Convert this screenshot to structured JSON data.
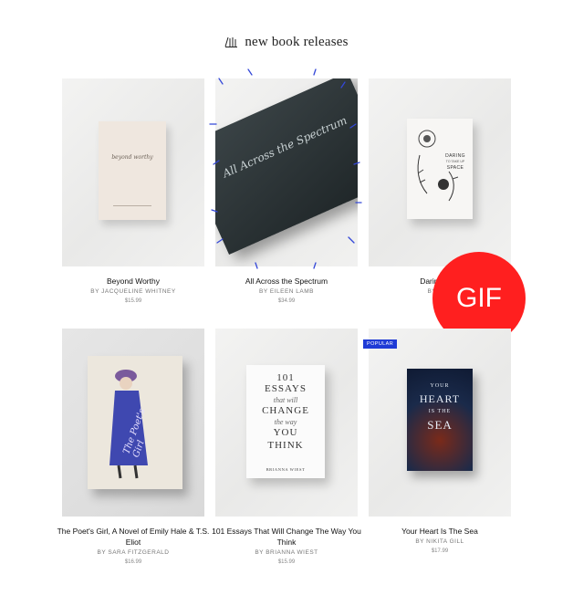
{
  "header": {
    "title": "new book releases"
  },
  "books": [
    {
      "title": "Beyond Worthy",
      "author": "BY JACQUELINE WHITNEY",
      "price": "$15.99",
      "cover_text": "beyond worthy"
    },
    {
      "title": "All Across the Spectrum",
      "author": "BY EILEEN LAMB",
      "price": "$34.99",
      "cover_text": "All Across the Spectrum"
    },
    {
      "title": "Daring To T",
      "author": "BY DAN",
      "price": "",
      "cover_text_1": "DARING",
      "cover_text_2": "TO TAKE UP",
      "cover_text_3": "SPACE"
    },
    {
      "title": "The Poet's Girl, A Novel of Emily Hale & T.S. Eliot",
      "author": "BY SARA FITZGERALD",
      "price": "$16.99",
      "cover_text": "The Poet's Girl"
    },
    {
      "title": "101 Essays That Will Change The Way You Think",
      "author": "BY BRIANNA WIEST",
      "price": "$15.99",
      "cover_lines": [
        "101",
        "ESSAYS",
        "that will",
        "CHANGE",
        "the way",
        "YOU",
        "THINK"
      ],
      "cover_author": "BRIANNA WIEST"
    },
    {
      "title": "Your Heart Is The Sea",
      "author": "BY NIKITA GILL",
      "price": "$17.99",
      "cover_lines": [
        "YOUR",
        "HEART",
        "IS THE",
        "SEA"
      ],
      "badge": "POPULAR"
    }
  ],
  "overlay": {
    "gif_label": "GIF"
  }
}
